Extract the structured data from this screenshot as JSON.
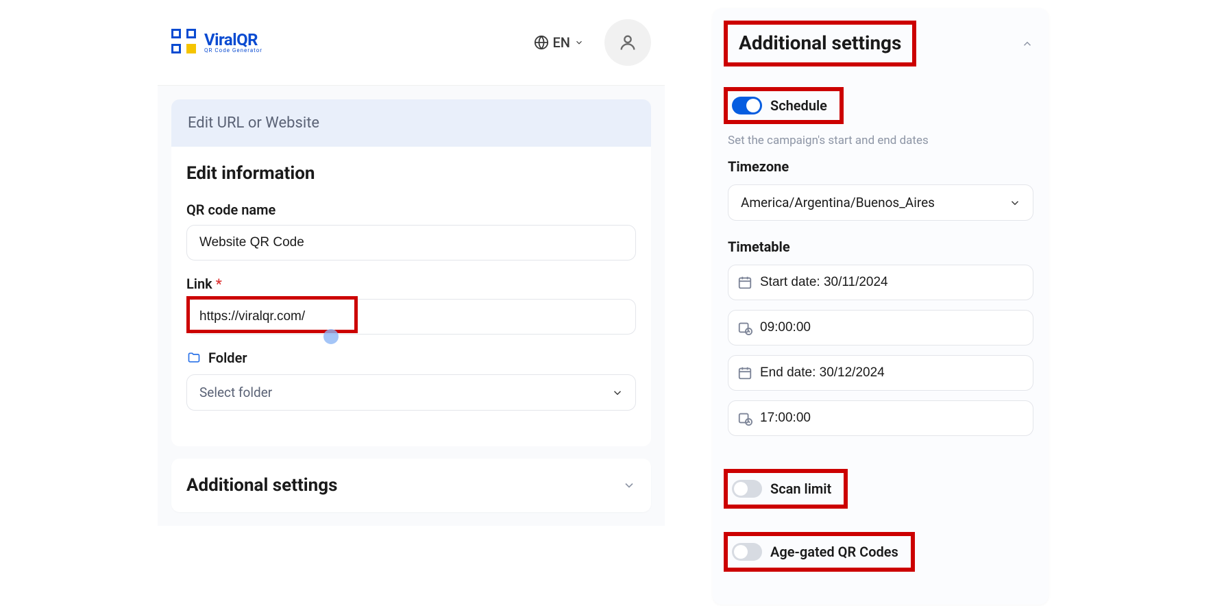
{
  "brand": {
    "name": "ViralQR",
    "tagline": "QR Code Generator"
  },
  "header": {
    "language": "EN"
  },
  "left": {
    "tab": "Edit URL or Website",
    "section_title": "Edit information",
    "qr_name_label": "QR code name",
    "qr_name_value": "Website QR Code",
    "link_label": "Link",
    "link_required": "*",
    "link_value": "https://viralqr.com/",
    "folder_label": "Folder",
    "folder_placeholder": "Select folder",
    "additional_settings": "Additional settings"
  },
  "right": {
    "title": "Additional settings",
    "schedule": {
      "label": "Schedule",
      "enabled": true,
      "hint": "Set the campaign's start and end dates",
      "timezone_label": "Timezone",
      "timezone_value": "America/Argentina/Buenos_Aires",
      "timetable_label": "Timetable",
      "start_date": "Start date: 30/11/2024",
      "start_time": "09:00:00",
      "end_date": "End date: 30/12/2024",
      "end_time": "17:00:00"
    },
    "scan_limit": {
      "label": "Scan limit",
      "enabled": false
    },
    "age_gated": {
      "label": "Age-gated QR Codes",
      "enabled": false
    }
  }
}
